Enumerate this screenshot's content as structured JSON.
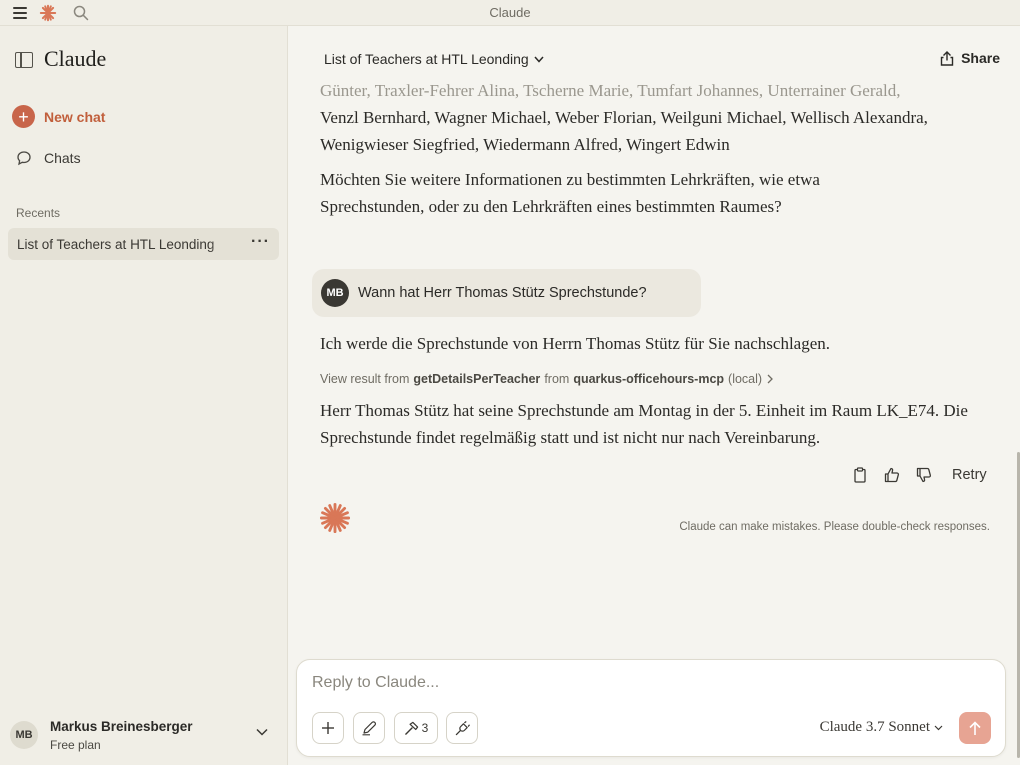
{
  "window": {
    "title": "Claude"
  },
  "sidebar": {
    "brand": "Claude",
    "new_chat": "New chat",
    "chats": "Chats",
    "recents_title": "Recents",
    "recents": [
      {
        "label": "List of Teachers at HTL Leonding",
        "more": "···"
      }
    ],
    "user": {
      "initials": "MB",
      "name": "Markus Breinesberger",
      "plan": "Free plan"
    }
  },
  "main": {
    "conversation_title": "List of Teachers at HTL Leonding",
    "share_label": "Share",
    "assistant_prev": {
      "line_faded": "Günter, Traxler-Fehrer Alina, Tscherne Marie, Tumfart Johannes, Unterrainer Gerald,",
      "line_1": "Venzl Bernhard, Wagner Michael, Weber Florian, Weilguni Michael, Wellisch Alexandra,",
      "line_2": "Wenigwieser Siegfried, Wiedermann Alfred, Wingert Edwin",
      "question": "Möchten Sie weitere Informationen zu bestimmten Lehrkräften, wie etwa Sprechstunden, oder zu den Lehrkräften eines bestimmten Raumes?"
    },
    "user_message": {
      "initials": "MB",
      "text": "Wann hat Herr Thomas Stütz Sprechstunde?"
    },
    "assistant_reply": {
      "intro": "Ich werde die Sprechstunde von Herrn Thomas Stütz für Sie nachschlagen.",
      "tool": {
        "prefix": "View result from",
        "function": "getDetailsPerTeacher",
        "from": "from",
        "server": "quarkus-officehours-mcp",
        "suffix": "(local)"
      },
      "answer": "Herr Thomas Stütz hat seine Sprechstunde am Montag in der 5. Einheit im Raum LK_E74. Die Sprechstunde findet regelmäßig statt und ist nicht nur nach Vereinbarung."
    },
    "actions": {
      "retry": "Retry"
    },
    "disclaimer": "Claude can make mistakes. Please double-check responses.",
    "composer": {
      "placeholder": "Reply to Claude...",
      "tools_count": "3",
      "model": "Claude 3.7 Sonnet"
    }
  },
  "colors": {
    "accent": "#c8654a",
    "send_button": "#e7a493",
    "background": "#f5f4ef",
    "sidebar": "#f0eee6"
  }
}
